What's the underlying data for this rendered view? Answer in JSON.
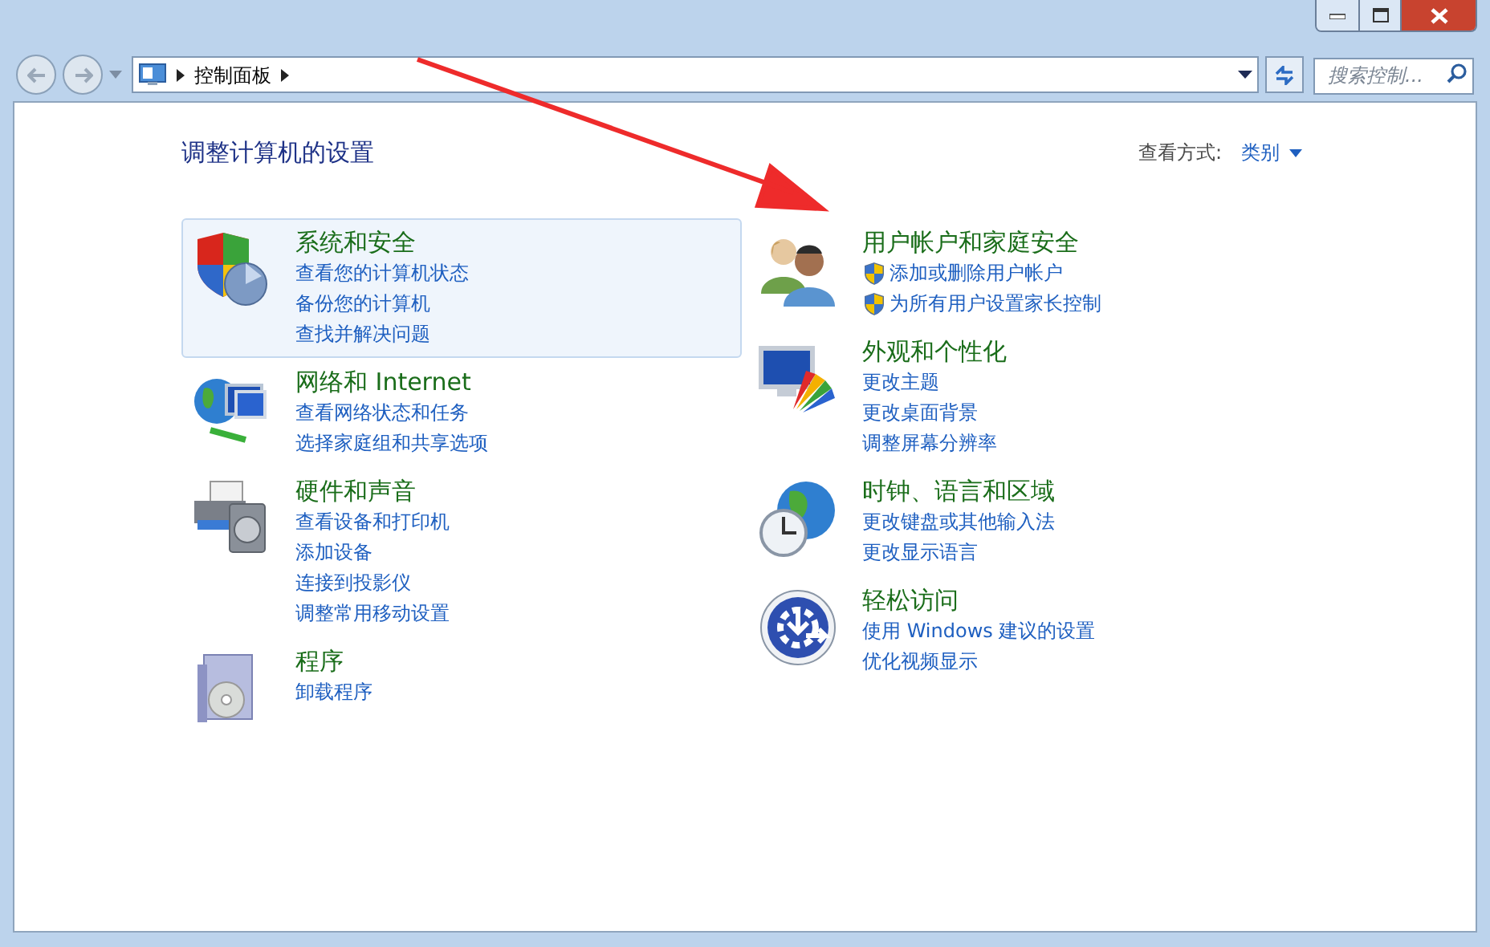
{
  "address_bar": {
    "path": [
      {
        "label": "控制面板"
      }
    ]
  },
  "search": {
    "placeholder": "搜索控制..."
  },
  "heading": "调整计算机的设置",
  "view_by": {
    "label": "查看方式:",
    "value": "类别"
  },
  "columns": [
    {
      "categories": [
        {
          "kind": "security",
          "title": "系统和安全",
          "highlighted": true,
          "links": [
            {
              "label": "查看您的计算机状态",
              "shield": false
            },
            {
              "label": "备份您的计算机",
              "shield": false
            },
            {
              "label": "查找并解决问题",
              "shield": false
            }
          ]
        },
        {
          "kind": "network",
          "title": "网络和 Internet",
          "highlighted": false,
          "links": [
            {
              "label": "查看网络状态和任务",
              "shield": false
            },
            {
              "label": "选择家庭组和共享选项",
              "shield": false
            }
          ]
        },
        {
          "kind": "hardware",
          "title": "硬件和声音",
          "highlighted": false,
          "links": [
            {
              "label": "查看设备和打印机",
              "shield": false
            },
            {
              "label": "添加设备",
              "shield": false
            },
            {
              "label": "连接到投影仪",
              "shield": false
            },
            {
              "label": "调整常用移动设置",
              "shield": false
            }
          ]
        },
        {
          "kind": "programs",
          "title": "程序",
          "highlighted": false,
          "links": [
            {
              "label": "卸载程序",
              "shield": false
            }
          ]
        }
      ]
    },
    {
      "categories": [
        {
          "kind": "users",
          "title": "用户帐户和家庭安全",
          "highlighted": false,
          "links": [
            {
              "label": "添加或删除用户帐户",
              "shield": true
            },
            {
              "label": "为所有用户设置家长控制",
              "shield": true
            }
          ]
        },
        {
          "kind": "appearance",
          "title": "外观和个性化",
          "highlighted": false,
          "links": [
            {
              "label": "更改主题",
              "shield": false
            },
            {
              "label": "更改桌面背景",
              "shield": false
            },
            {
              "label": "调整屏幕分辨率",
              "shield": false
            }
          ]
        },
        {
          "kind": "clock",
          "title": "时钟、语言和区域",
          "highlighted": false,
          "links": [
            {
              "label": "更改键盘或其他输入法",
              "shield": false
            },
            {
              "label": "更改显示语言",
              "shield": false
            }
          ]
        },
        {
          "kind": "access",
          "title": "轻松访问",
          "highlighted": false,
          "links": [
            {
              "label": "使用 Windows 建议的设置",
              "shield": false
            },
            {
              "label": "优化视频显示",
              "shield": false
            }
          ]
        }
      ]
    }
  ]
}
